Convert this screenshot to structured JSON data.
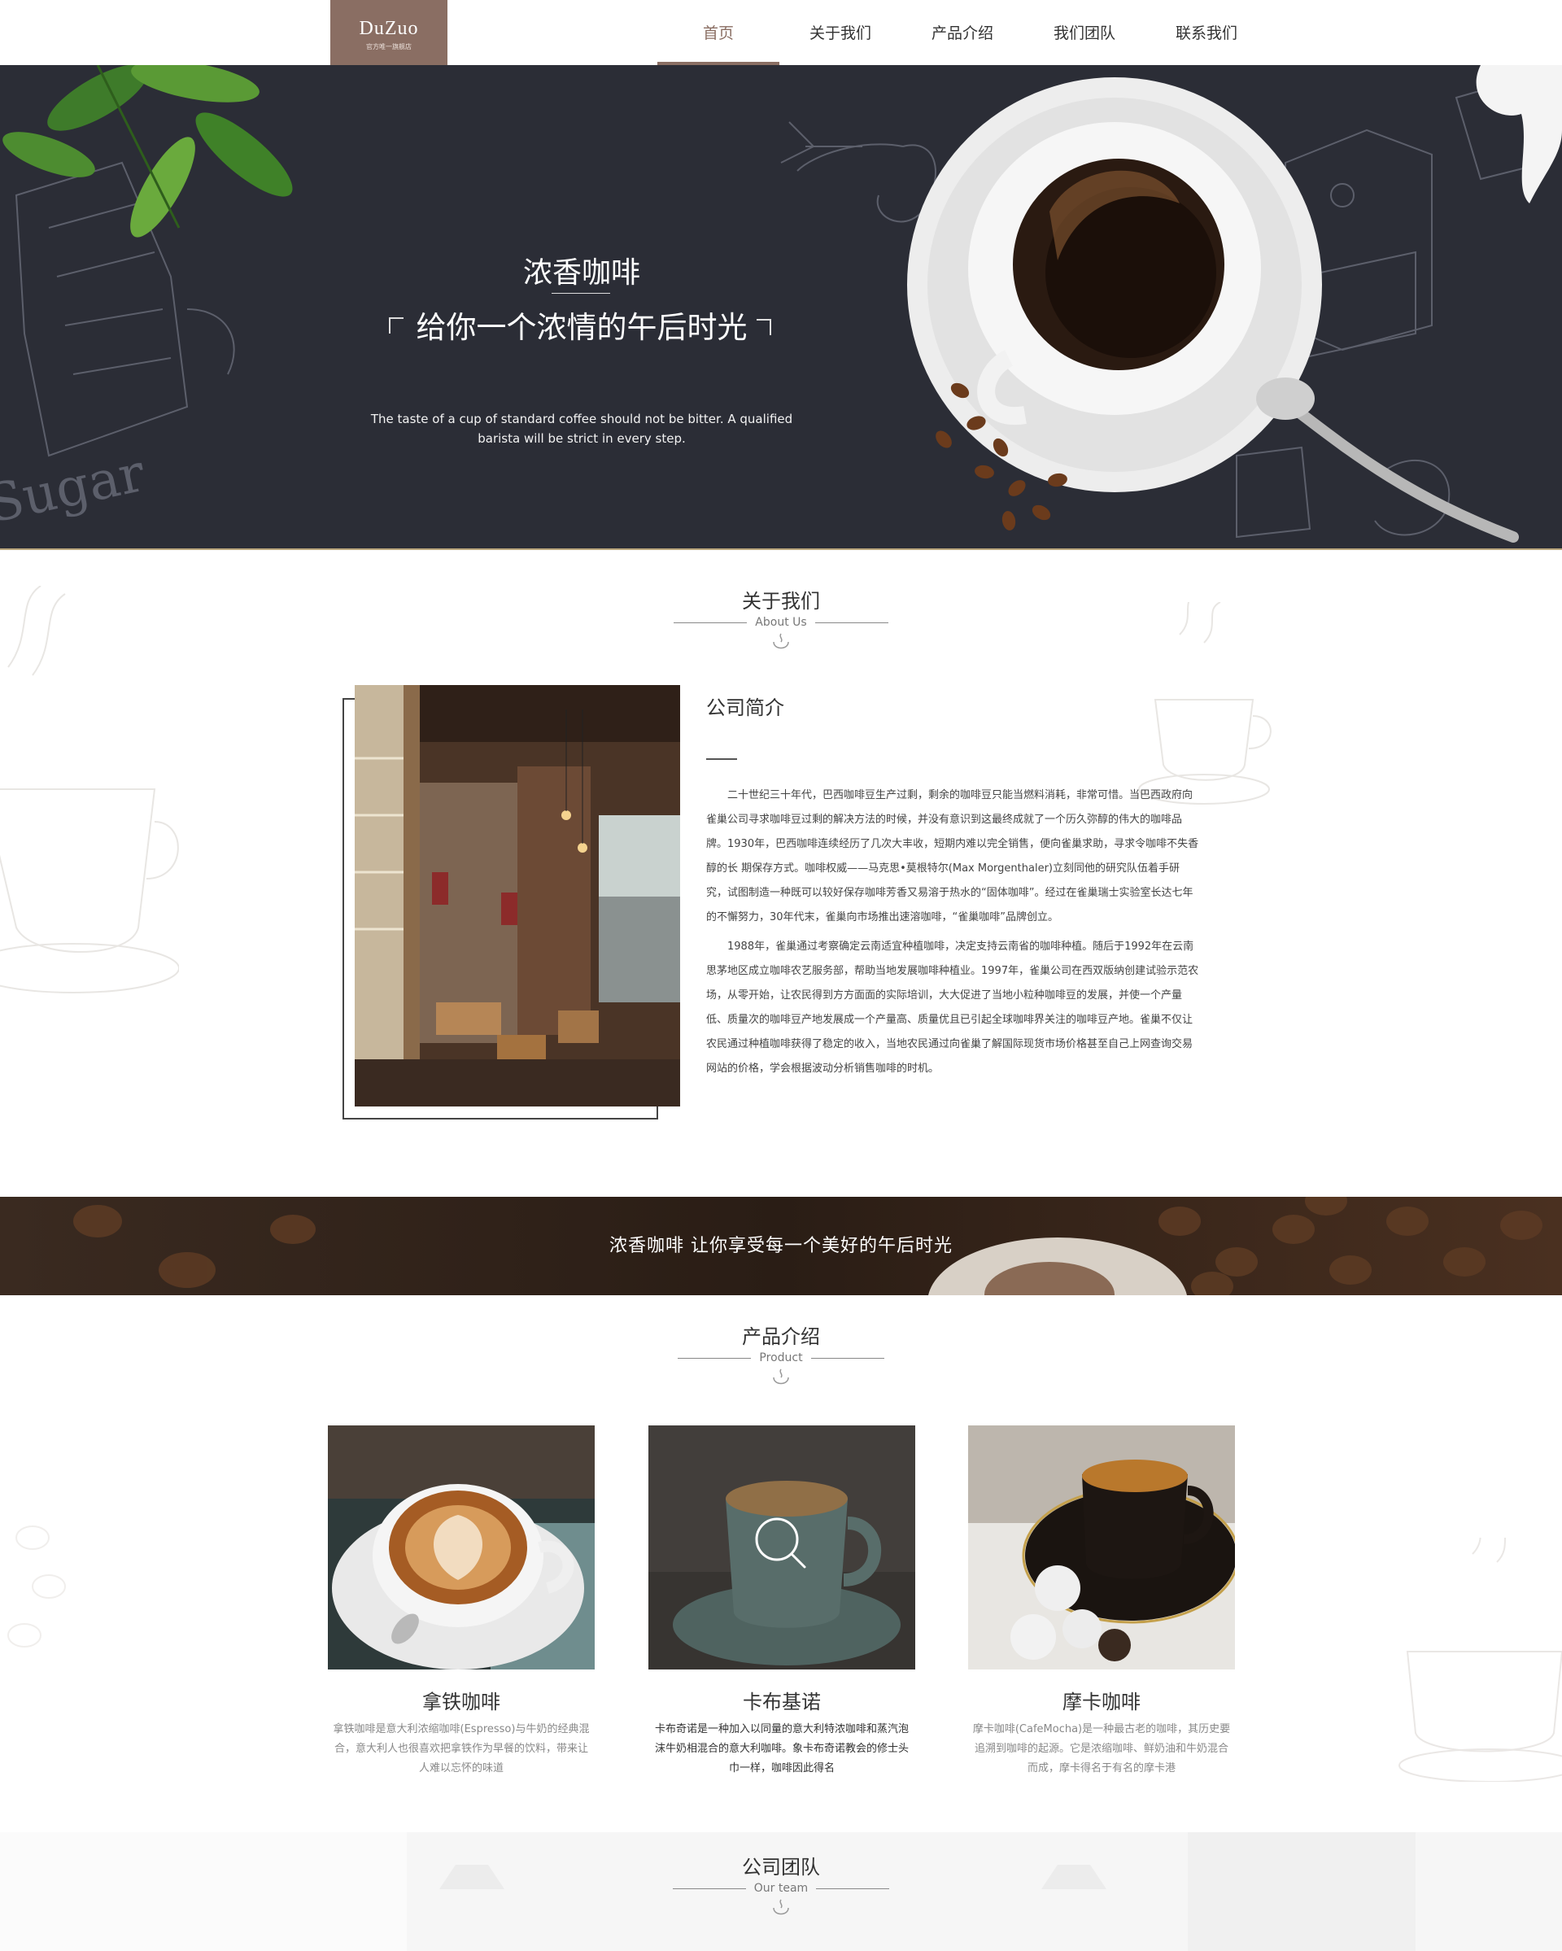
{
  "nav": {
    "logo_text": "DuZuo",
    "logo_sub": "官方唯一旗舰店",
    "items": [
      {
        "label": "首页",
        "active": true
      },
      {
        "label": "关于我们",
        "active": false
      },
      {
        "label": "产品介绍",
        "active": false
      },
      {
        "label": "我们团队",
        "active": false
      },
      {
        "label": "联系我们",
        "active": false
      }
    ],
    "accent_color": "#8a6e63"
  },
  "hero": {
    "title": "浓香咖啡",
    "subtitle": "给你一个浓情的午后时光",
    "description": "The taste of a cup of standard coffee should not be bitter. A qualified barista will be strict in every step.",
    "sketch_text": "Sugar",
    "background_color": "#2b2d36"
  },
  "about": {
    "title_zh": "关于我们",
    "title_en": "About Us",
    "heading": "公司简介",
    "paragraphs": [
      "二十世纪三十年代，巴西咖啡豆生产过剩，剩余的咖啡豆只能当燃料消耗，非常可惜。当巴西政府向雀巢公司寻求咖啡豆过剩的解决方法的时候，并没有意识到这最终成就了一个历久弥醇的伟大的咖啡品牌。1930年，巴西咖啡连续经历了几次大丰收，短期内难以完全销售，便向雀巢求助，寻求令咖啡不失香醇的长 期保存方式。咖啡权威——马克思•莫根特尔(Max Morgenthaler)立刻同他的研究队伍着手研究，试图制造一种既可以较好保存咖啡芳香又易溶于热水的“固体咖啡”。经过在雀巢瑞士实验室长达七年的不懈努力，30年代末，雀巢向市场推出速溶咖啡，“雀巢咖啡”品牌创立。",
      "1988年，雀巢通过考察确定云南适宜种植咖啡，决定支持云南省的咖啡种植。随后于1992年在云南思茅地区成立咖啡农艺服务部，帮助当地发展咖啡种植业。1997年，雀巢公司在西双版纳创建试验示范农场，从零开始，让农民得到方方面面的实际培训，大大促进了当地小粒种咖啡豆的发展，并使一个产量低、质量次的咖啡豆产地发展成一个产量高、质量优且已引起全球咖啡界关注的咖啡豆产地。雀巢不仅让农民通过种植咖啡获得了稳定的收入，当地农民通过向雀巢了解国际现货市场价格甚至自己上网查询交易网站的价格，学会根据波动分析销售咖啡的时机。"
    ]
  },
  "banner": {
    "text": "浓香咖啡  让你享受每一个美好的午后时光"
  },
  "products": {
    "title_zh": "产品介绍",
    "title_en": "Product",
    "items": [
      {
        "name": "拿铁咖啡",
        "desc": "拿铁咖啡是意大利浓缩咖啡(Espresso)与牛奶的经典混合，意大利人也很喜欢把拿铁作为早餐的饮料，带来让人难以忘怀的味道"
      },
      {
        "name": "卡布基诺",
        "desc": "卡布奇诺是一种加入以同量的意大利特浓咖啡和蒸汽泡沫牛奶相混合的意大利咖啡。象卡布奇诺教会的修士头巾一样，咖啡因此得名"
      },
      {
        "name": "摩卡咖啡",
        "desc": "摩卡咖啡(CafeMocha)是一种最古老的咖啡，其历史要追溯到咖啡的起源。它是浓缩咖啡、鲜奶油和牛奶混合而成，摩卡得名于有名的摩卡港"
      }
    ]
  },
  "team": {
    "title_zh": "公司团队",
    "title_en": "Our team"
  }
}
